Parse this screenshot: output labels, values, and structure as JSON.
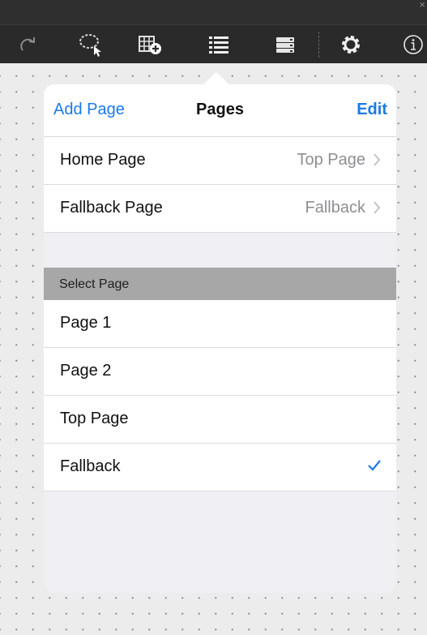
{
  "window": {
    "close_glyph": "×"
  },
  "toolbar": {
    "items": [
      {
        "name": "redo-icon"
      },
      {
        "name": "lasso-select-icon"
      },
      {
        "name": "add-table-icon"
      },
      {
        "name": "pages-list-icon"
      },
      {
        "name": "stack-icon"
      },
      {
        "name": "gear-icon"
      },
      {
        "name": "info-icon"
      }
    ]
  },
  "popover": {
    "add_label": "Add Page",
    "title": "Pages",
    "edit_label": "Edit",
    "settings_rows": [
      {
        "label": "Home Page",
        "value": "Top Page"
      },
      {
        "label": "Fallback Page",
        "value": "Fallback"
      }
    ],
    "section_header": "Select Page",
    "pages": [
      {
        "label": "Page 1",
        "selected": false
      },
      {
        "label": "Page 2",
        "selected": false
      },
      {
        "label": "Top Page",
        "selected": false
      },
      {
        "label": "Fallback",
        "selected": true
      }
    ]
  },
  "colors": {
    "accent": "#1a7ae8",
    "toolbar_bg": "#2a2a2a",
    "section_header_bg": "#a7a7a7"
  }
}
